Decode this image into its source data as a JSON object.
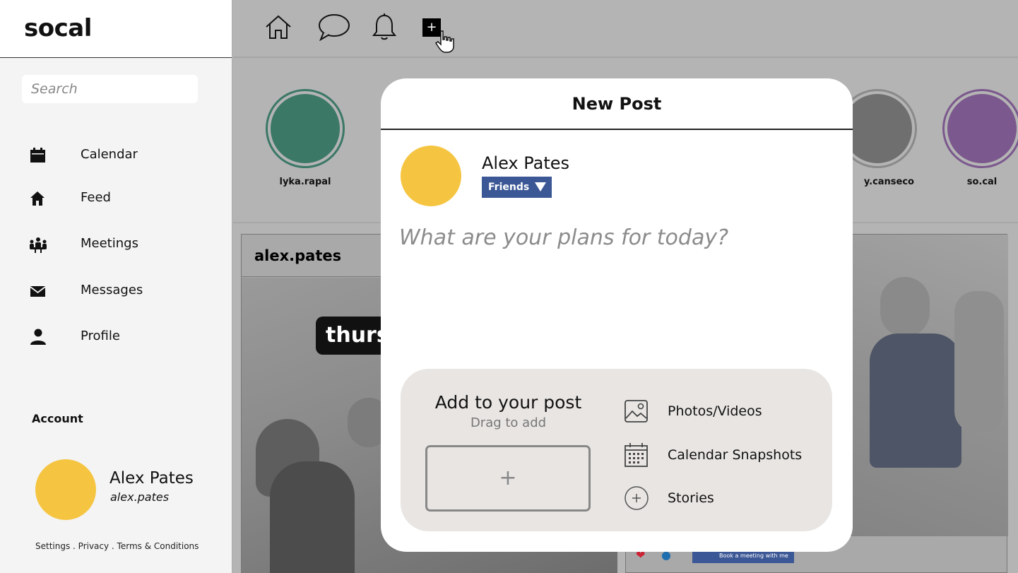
{
  "app": {
    "logo": "socal"
  },
  "sidebar": {
    "search_placeholder": "Search",
    "items": [
      {
        "label": "Calendar",
        "icon": "calendar-icon"
      },
      {
        "label": "Feed",
        "icon": "home-icon"
      },
      {
        "label": "Meetings",
        "icon": "meeting-icon"
      },
      {
        "label": "Messages",
        "icon": "mail-icon"
      },
      {
        "label": "Profile",
        "icon": "person-icon"
      }
    ],
    "account": {
      "title": "Account",
      "name": "Alex Pates",
      "handle": "alex.pates",
      "avatar_color": "#f5c542"
    },
    "footer": "Settings . Privacy . Terms & Conditions"
  },
  "topbar": {
    "icons": [
      "home-icon",
      "chat-icon",
      "bell-icon",
      "new-post-icon"
    ],
    "new_post_symbol": "+"
  },
  "stories": [
    {
      "name": "lyka.rapal",
      "color": "#3b7866"
    },
    {
      "name": "y.canseco",
      "color": "#6f6f6f"
    },
    {
      "name": "so.cal",
      "color": "#7b588d"
    }
  ],
  "feed": {
    "post_author": "alex.pates",
    "post_overlay_text": "thurs",
    "book_button": "Book a meeting with me"
  },
  "modal": {
    "title": "New Post",
    "user_name": "Alex Pates",
    "avatar_color": "#f5c542",
    "audience": "Friends",
    "audience_color": "#3b5796",
    "compose_placeholder": "What are your plans for today?",
    "add": {
      "title": "Add to your post",
      "subtitle": "Drag to add",
      "drop_symbol": "+",
      "options": [
        {
          "label": "Photos/Videos",
          "icon": "image-icon"
        },
        {
          "label": "Calendar Snapshots",
          "icon": "calendar-grid-icon"
        },
        {
          "label": "Stories",
          "icon": "plus-circle-icon"
        }
      ]
    }
  }
}
